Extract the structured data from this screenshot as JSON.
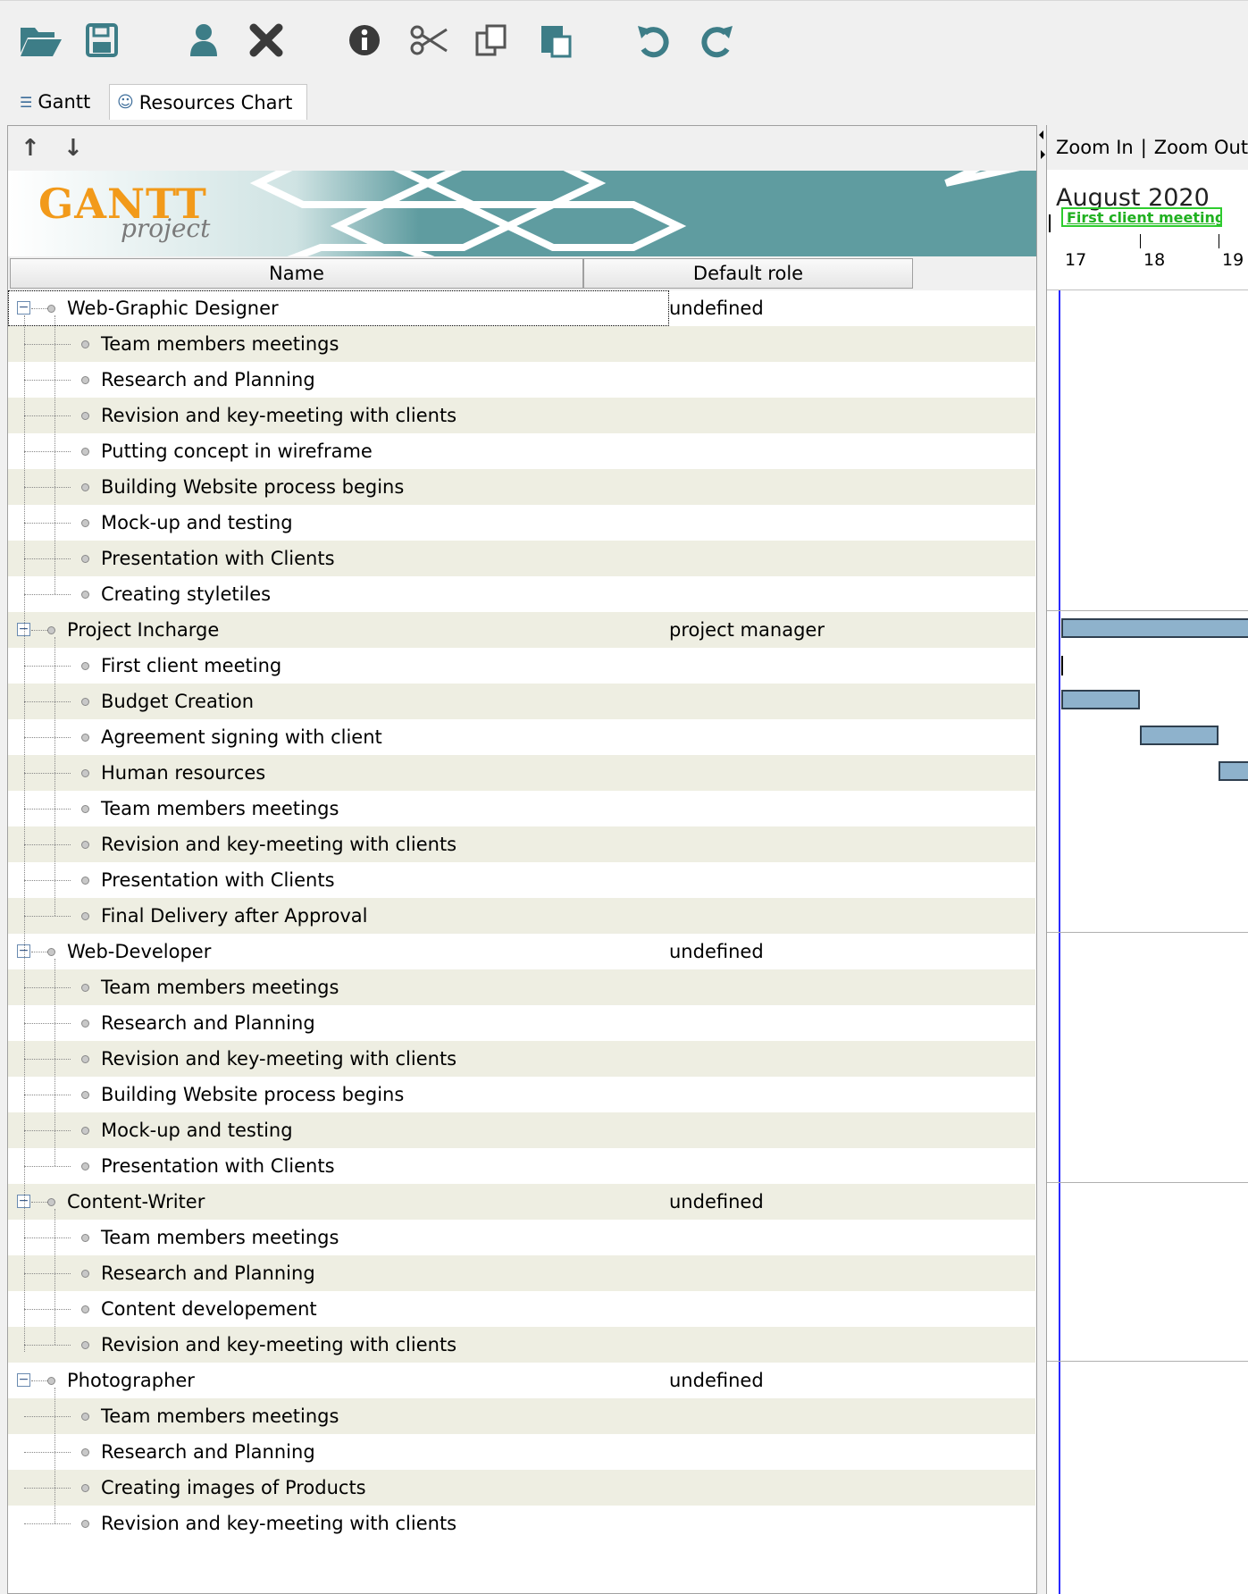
{
  "tabs": [
    {
      "label": "Gantt",
      "icon": "gantt-tree-icon"
    },
    {
      "label": "Resources Chart",
      "icon": "resources-people-icon"
    }
  ],
  "toolbar_icons": [
    "open-folder-icon",
    "save-icon",
    "user-icon",
    "delete-icon",
    "info-icon",
    "cut-icon",
    "copy-icon",
    "paste-icon",
    "undo-icon",
    "redo-icon"
  ],
  "banner": {
    "logo_big": "GANTT",
    "logo_small": "project"
  },
  "columns": {
    "name": "Name",
    "role": "Default role"
  },
  "zoom": {
    "zoom_in": "Zoom In",
    "separator": "|",
    "zoom_out": "Zoom Out"
  },
  "timeline": {
    "month": "August 2020",
    "milestone_label": "First client meeting",
    "days": [
      "17",
      "18",
      "19"
    ]
  },
  "rows": [
    {
      "name": "Web-Graphic Designer",
      "role": "undefined",
      "level": 0
    },
    {
      "name": "Team members meetings",
      "level": 1
    },
    {
      "name": "Research and Planning",
      "level": 1
    },
    {
      "name": "Revision and key-meeting with clients",
      "level": 1
    },
    {
      "name": "Putting  concept in wireframe",
      "level": 1
    },
    {
      "name": "Building Website process begins",
      "level": 1
    },
    {
      "name": "Mock-up and testing",
      "level": 1
    },
    {
      "name": "Presentation with Clients",
      "level": 1
    },
    {
      "name": "Creating styletiles",
      "level": 1
    },
    {
      "name": "Project Incharge",
      "role": "project manager",
      "level": 0
    },
    {
      "name": "First client meeting",
      "level": 1
    },
    {
      "name": "Budget Creation",
      "level": 1
    },
    {
      "name": "Agreement signing with client",
      "level": 1
    },
    {
      "name": "Human resources",
      "level": 1
    },
    {
      "name": "Team members meetings",
      "level": 1
    },
    {
      "name": "Revision and key-meeting with clients",
      "level": 1
    },
    {
      "name": "Presentation with Clients",
      "level": 1
    },
    {
      "name": "Final Delivery after Approval",
      "level": 1
    },
    {
      "name": "Web-Developer",
      "role": "undefined",
      "level": 0
    },
    {
      "name": "Team members meetings",
      "level": 1
    },
    {
      "name": "Research and Planning",
      "level": 1
    },
    {
      "name": "Revision and key-meeting with clients",
      "level": 1
    },
    {
      "name": "Building Website process begins",
      "level": 1
    },
    {
      "name": "Mock-up and testing",
      "level": 1
    },
    {
      "name": "Presentation with Clients",
      "level": 1
    },
    {
      "name": "Content-Writer",
      "role": "undefined",
      "level": 0
    },
    {
      "name": "Team members meetings",
      "level": 1
    },
    {
      "name": "Research and Planning",
      "level": 1
    },
    {
      "name": "Content developement",
      "level": 1
    },
    {
      "name": "Revision and key-meeting with clients",
      "level": 1
    },
    {
      "name": "Photographer",
      "role": "undefined",
      "level": 0
    },
    {
      "name": "Team members meetings",
      "level": 1
    },
    {
      "name": "Research and Planning",
      "level": 1
    },
    {
      "name": "Creating images of Products",
      "level": 1
    },
    {
      "name": "Revision and key-meeting with clients",
      "level": 1
    }
  ],
  "colors": {
    "row_alt": "#eeeee2",
    "bar": "#8eb2cc",
    "milestone": "#2ecc2e",
    "banner": "#5f9ca0",
    "today_line": "#2a2aff"
  }
}
